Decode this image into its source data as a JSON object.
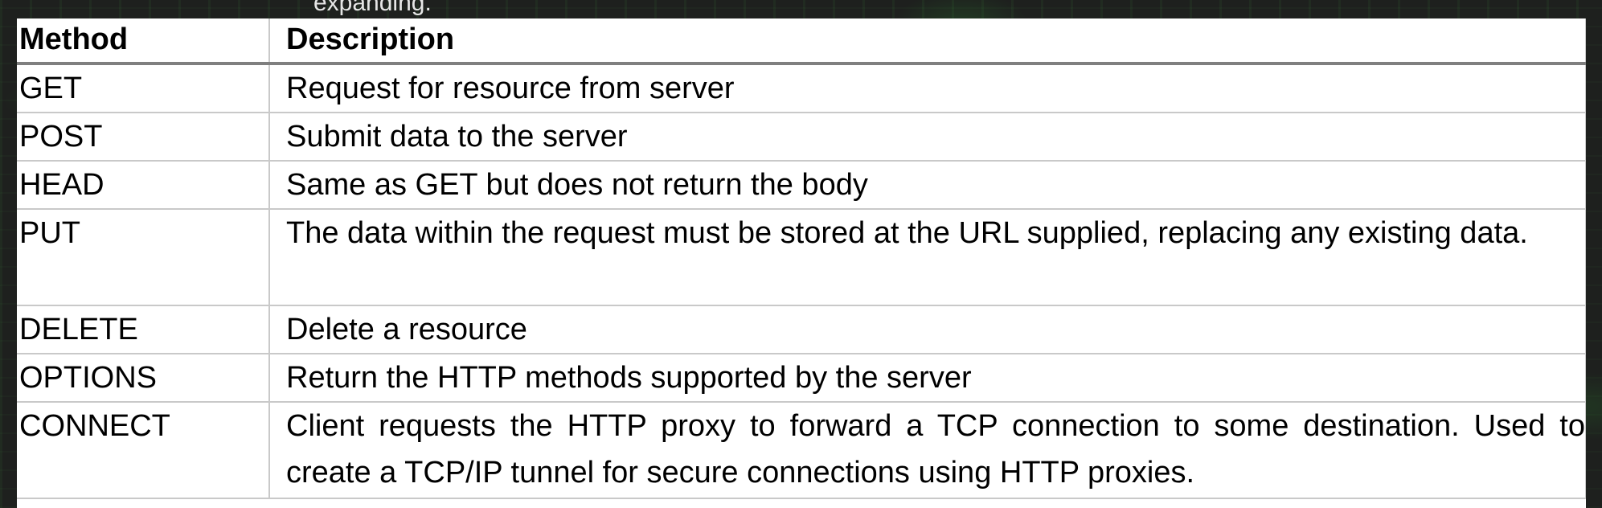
{
  "caption": "expanding.",
  "table": {
    "headers": {
      "method": "Method",
      "description": "Description"
    },
    "rows": [
      {
        "method": "GET",
        "description": "Request for resource from server"
      },
      {
        "method": "POST",
        "description": "Submit data to the server"
      },
      {
        "method": "HEAD",
        "description": "Same as GET but does not return the body"
      },
      {
        "method": "PUT",
        "description": "The data within the request must be stored at the URL supplied, replacing any existing data."
      },
      {
        "method": "DELETE",
        "description": "Delete a resource"
      },
      {
        "method": "OPTIONS",
        "description": "Return the HTTP methods supported by the server"
      },
      {
        "method": "CONNECT",
        "description": "Client requests the HTTP proxy to forward a TCP connection to some destination. Used to create a TCP/IP tunnel for secure connections using HTTP proxies."
      }
    ]
  },
  "colors": {
    "background": "#1e201e",
    "table_background": "#ffffff",
    "header_rule": "#7f7f7f",
    "grid_line": "#c9c9c9"
  }
}
